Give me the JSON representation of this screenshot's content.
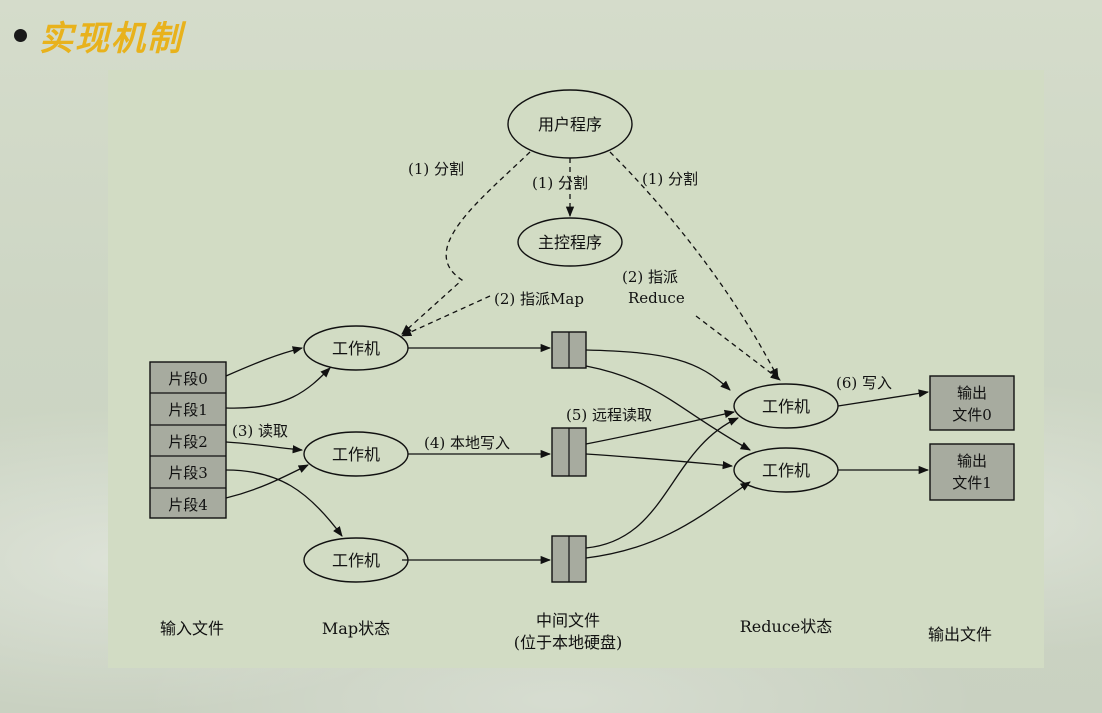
{
  "heading": "实现机制",
  "nodes": {
    "user_program": "用户程序",
    "master": "主控程序",
    "worker_map_1": "工作机",
    "worker_map_2": "工作机",
    "worker_map_3": "工作机",
    "worker_reduce_1": "工作机",
    "worker_reduce_2": "工作机"
  },
  "splits": [
    "片段0",
    "片段1",
    "片段2",
    "片段3",
    "片段4"
  ],
  "outputs": [
    {
      "line1": "输出",
      "line2": "文件0"
    },
    {
      "line1": "输出",
      "line2": "文件1"
    }
  ],
  "edge_labels": {
    "fork_left": "(1) 分割",
    "fork_mid": "(1) 分割",
    "fork_right": "(1) 分割",
    "assign_map": "(2) 指派Map",
    "assign_reduce_1": "(2) 指派",
    "assign_reduce_2": "Reduce",
    "read": "(3) 读取",
    "local_write": "(4) 本地写入",
    "remote_read": "(5) 远程读取",
    "write": "(6) 写入"
  },
  "stage_labels": {
    "input": "输入文件",
    "map": "Map状态",
    "intermediate_1": "中间文件",
    "intermediate_2": "(位于本地硬盘)",
    "reduce": "Reduce状态",
    "output": "输出文件"
  }
}
